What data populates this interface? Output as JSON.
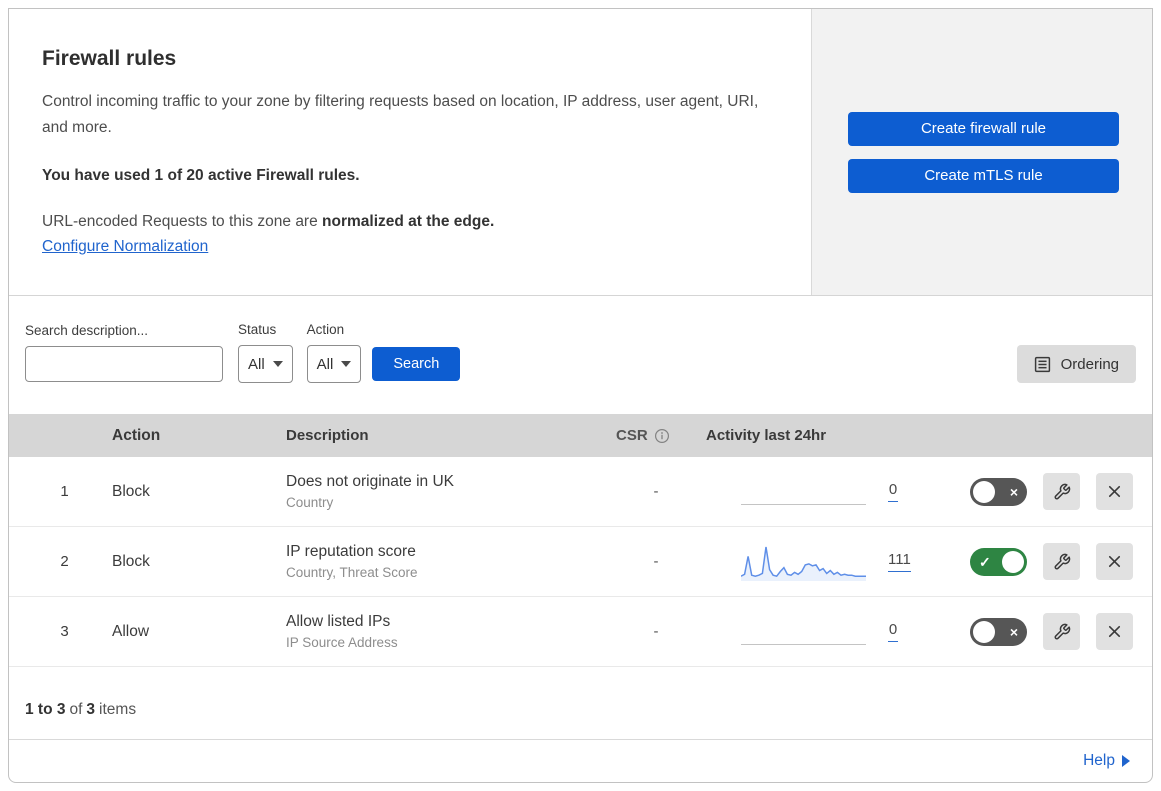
{
  "header": {
    "title": "Firewall rules",
    "description": "Control incoming traffic to your zone by filtering requests based on location, IP address, user agent, URI, and more.",
    "usage_line": "You have used 1 of 20 active Firewall rules.",
    "normalization_text": "URL-encoded Requests to this zone are",
    "normalization_bold": "normalized at the edge.",
    "normalization_link": "Configure Normalization",
    "buttons": {
      "create_firewall": "Create firewall rule",
      "create_mtls": "Create mTLS rule"
    }
  },
  "filters": {
    "search_label": "Search description...",
    "search_value": "",
    "status_label": "Status",
    "status_value": "All",
    "action_label": "Action",
    "action_value": "All",
    "search_button": "Search",
    "ordering_button": "Ordering"
  },
  "table": {
    "columns": {
      "action": "Action",
      "description": "Description",
      "csr": "CSR",
      "activity": "Activity last 24hr"
    },
    "rows": [
      {
        "index": "1",
        "action": "Block",
        "title": "Does not originate in UK",
        "subtitle": "Country",
        "csr": "-",
        "count": "0",
        "enabled": false,
        "sparkline": null
      },
      {
        "index": "2",
        "action": "Block",
        "title": "IP reputation score",
        "subtitle": "Country, Threat Score",
        "csr": "-",
        "count": "111",
        "enabled": true,
        "sparkline": [
          3,
          5,
          24,
          4,
          3,
          4,
          6,
          34,
          10,
          4,
          3,
          8,
          12,
          5,
          4,
          7,
          5,
          8,
          15,
          16,
          14,
          15,
          9,
          11,
          6,
          9,
          5,
          7,
          4,
          5,
          4,
          4,
          3,
          3,
          3,
          3
        ]
      },
      {
        "index": "3",
        "action": "Allow",
        "title": "Allow listed IPs",
        "subtitle": "IP Source Address",
        "csr": "-",
        "count": "0",
        "enabled": false,
        "sparkline": null
      }
    ]
  },
  "footer": {
    "range_bold": "1 to 3",
    "of_text": "of",
    "total_bold": "3",
    "items_text": "items",
    "help_label": "Help"
  },
  "icons": {
    "toggle_on_mark": "✓",
    "toggle_off_mark": "×"
  },
  "colors": {
    "accent_blue": "#0d5dd1",
    "link_blue": "#2064cd",
    "toggle_on_green": "#2e8543",
    "toggle_off_gray": "#565656",
    "sparkline_blue": "#5f8fe8",
    "table_header_gray": "#d6d6d6",
    "side_panel_gray": "#f2f2f2"
  }
}
